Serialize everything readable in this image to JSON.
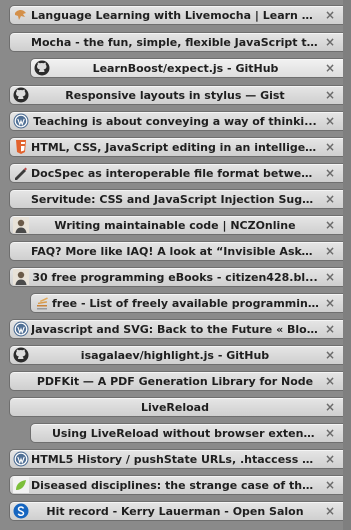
{
  "tabs": [
    {
      "icon": "livemocha-icon",
      "title": "Language Learning with Livemocha | Learn a..."
    },
    {
      "icon": "none",
      "title": "Mocha - the fun, simple, flexible JavaScript t..."
    },
    {
      "icon": "github-icon",
      "title": "LearnBoost/expect.js - GitHub"
    },
    {
      "icon": "github-icon",
      "title": "Responsive layouts in stylus — Gist"
    },
    {
      "icon": "wordpress-icon",
      "title": "Teaching is about conveying a way of thinki..."
    },
    {
      "icon": "html5-icon",
      "title": "HTML, CSS, JavaScript editing in an intelligen..."
    },
    {
      "icon": "docspec-icon",
      "title": "DocSpec as interoperable file format betwee..."
    },
    {
      "icon": "none",
      "title": "Servitude: CSS and JavaScript Injection Sugar..."
    },
    {
      "icon": "avatar-icon",
      "title": "Writing maintainable code | NCZOnline"
    },
    {
      "icon": "none",
      "title": "FAQ? More like IAQ! A look at “Invisible Aske..."
    },
    {
      "icon": "avatar-icon",
      "title": "30 free programming eBooks - citizen428.bl..."
    },
    {
      "icon": "stack-icon",
      "title": "free - List of freely available programming..."
    },
    {
      "icon": "wordpress-icon",
      "title": "Javascript and SVG: Back to the Future « Blog..."
    },
    {
      "icon": "github-icon",
      "title": "isagalaev/highlight.js - GitHub"
    },
    {
      "icon": "none",
      "title": "PDFKit — A PDF Generation Library for Node"
    },
    {
      "icon": "none",
      "title": "LiveReload"
    },
    {
      "icon": "none",
      "title": "Using LiveReload without browser extensi..."
    },
    {
      "icon": "wordpress-icon",
      "title": "HTML5 History / pushState URLs, .htaccess a..."
    },
    {
      "icon": "leaf-icon",
      "title": "Diseased disciplines: the strange case of the..."
    },
    {
      "icon": "salon-icon",
      "title": "Hit record - Kerry Lauerman - Open Salon"
    }
  ],
  "close_glyph": "×"
}
